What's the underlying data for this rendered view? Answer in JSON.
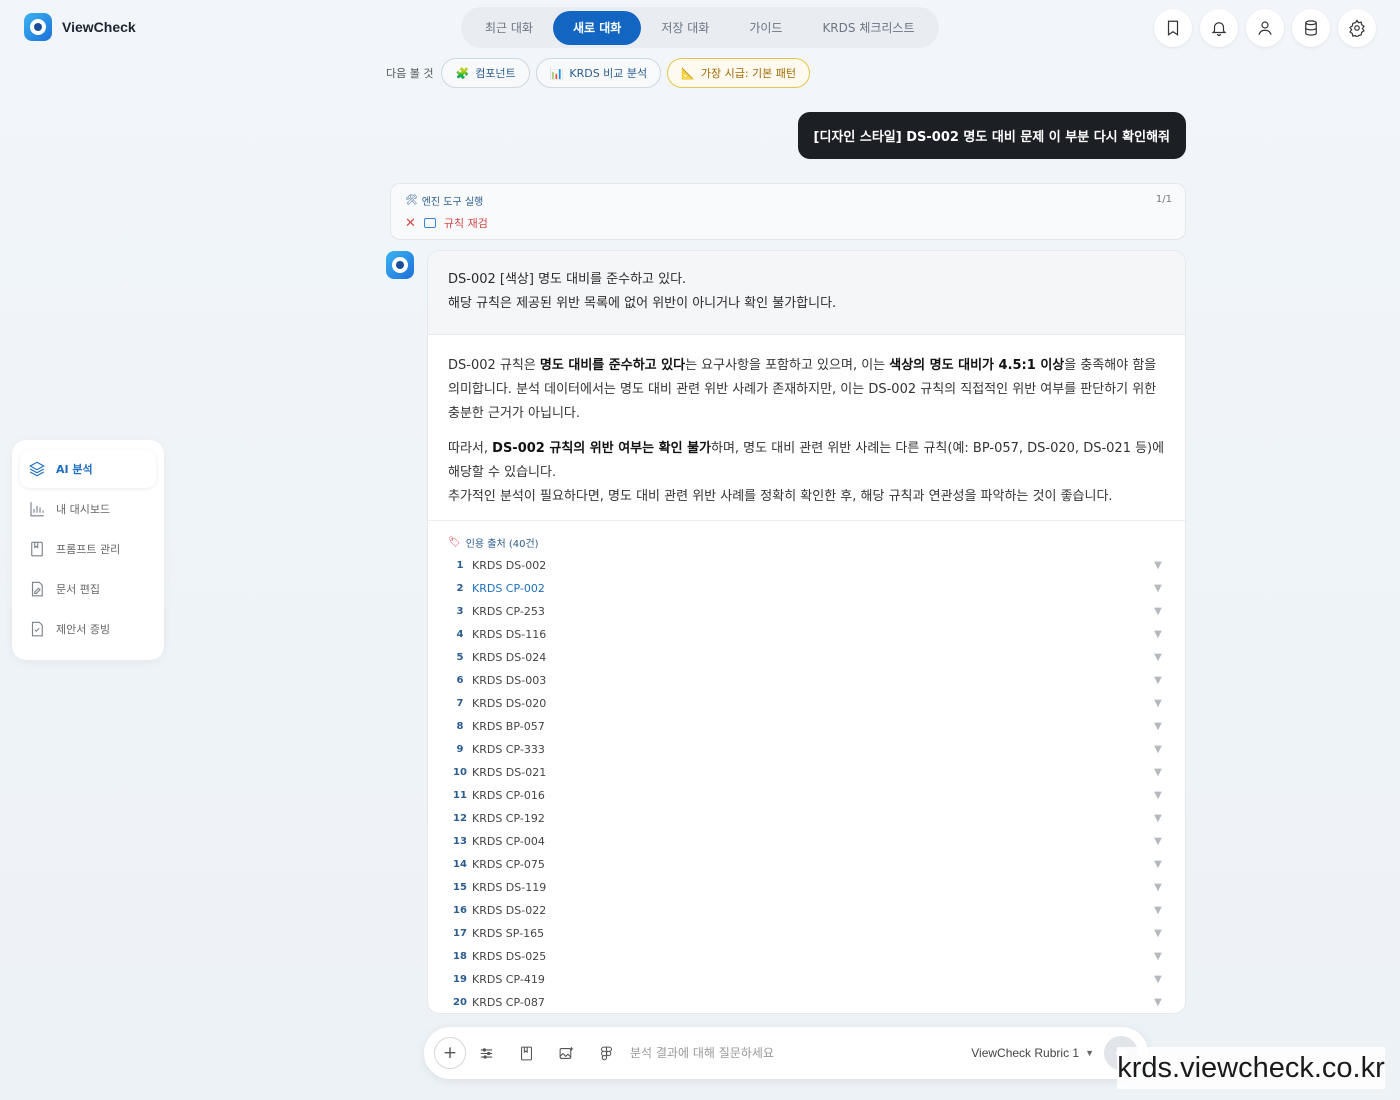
{
  "app": {
    "name": "ViewCheck"
  },
  "tabs": [
    "최근 대화",
    "새로 대화",
    "저장 대화",
    "가이드",
    "KRDS 체크리스트"
  ],
  "next": {
    "label": "다음 볼 것",
    "chips": [
      {
        "icon": "🧩",
        "label": "컴포넌트"
      },
      {
        "icon": "📊",
        "label": "KRDS 비교 분석"
      },
      {
        "icon": "📐",
        "label": "가장 시급: 기본 패턴"
      }
    ]
  },
  "user_message": "[디자인 스타일] DS-002 명도 대비 문제 이 부분 다시 확인해줘",
  "tool": {
    "title": "엔진 도구 실행",
    "count": "1/1",
    "step": "규칙 재검"
  },
  "answer": {
    "summary_line1": "DS-002 [색상] 명도 대비를 준수하고 있다.",
    "summary_line2": "해당 규칙은 제공된 위반 목록에 없어 위반이 아니거나 확인 불가합니다.",
    "p1_a": "DS-002 규칙은 ",
    "p1_b": "명도 대비를 준수하고 있다",
    "p1_c": "는 요구사항을 포함하고 있으며, 이는 ",
    "p1_d": "색상의 명도 대비가 4.5:1 이상",
    "p1_e": "을 충족해야 함을 의미합니다. 분석 데이터에서는 명도 대비 관련 위반 사례가 존재하지만, 이는 DS-002 규칙의 직접적인 위반 여부를 판단하기 위한 충분한 근거가 아닙니다.",
    "p2_a": "따라서, ",
    "p2_b": "DS-002 규칙의 위반 여부는 확인 불가",
    "p2_c": "하며, 명도 대비 관련 위반 사례는 다른 규칙(예: BP-057, DS-020, DS-021 등)에 해당할 수 있습니다.",
    "p2_d": "추가적인 분석이 필요하다면, 명도 대비 관련 위반 사례를 정확히 확인한 후, 해당 규칙과 연관성을 파악하는 것이 좋습니다."
  },
  "sources": {
    "title": "인용 출처 (40건)",
    "items": [
      "KRDS DS-002",
      "KRDS CP-002",
      "KRDS CP-253",
      "KRDS DS-116",
      "KRDS DS-024",
      "KRDS DS-003",
      "KRDS DS-020",
      "KRDS BP-057",
      "KRDS CP-333",
      "KRDS DS-021",
      "KRDS CP-016",
      "KRDS CP-192",
      "KRDS CP-004",
      "KRDS CP-075",
      "KRDS DS-119",
      "KRDS DS-022",
      "KRDS SP-165",
      "KRDS DS-025",
      "KRDS CP-419",
      "KRDS CP-087"
    ],
    "highlight_index": 1
  },
  "sidebar": {
    "items": [
      {
        "label": "AI 분석",
        "icon": "layers-icon"
      },
      {
        "label": "내 대시보드",
        "icon": "bar-chart-icon"
      },
      {
        "label": "프롬프트 관리",
        "icon": "bookmark-book-icon"
      },
      {
        "label": "문서 편집",
        "icon": "document-edit-icon"
      },
      {
        "label": "제안서 증빙",
        "icon": "document-check-icon"
      }
    ]
  },
  "input": {
    "placeholder": "분석 결과에 대해 질문하세요",
    "model": "ViewCheck Rubric 1"
  },
  "watermark": "krds.viewcheck.co.kr",
  "colors": {
    "accent": "#1266c2",
    "user_bubble": "#1c1f24",
    "danger": "#d34a4a"
  }
}
